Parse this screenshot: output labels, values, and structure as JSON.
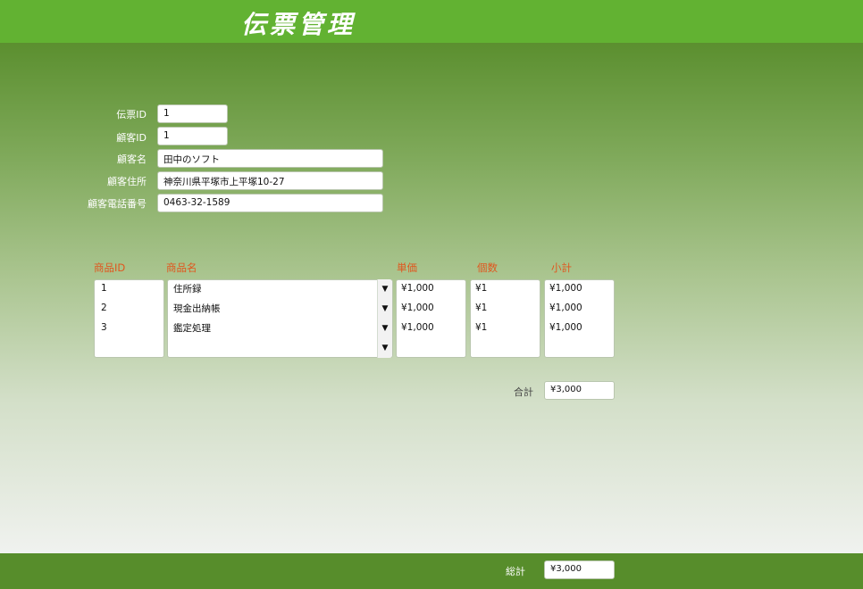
{
  "header": {
    "title": "伝票管理"
  },
  "form": {
    "voucher_id": {
      "label": "伝票ID",
      "value": "1"
    },
    "customer_id": {
      "label": "顧客ID",
      "value": "1"
    },
    "customer_name": {
      "label": "顧客名",
      "value": "田中のソフト"
    },
    "customer_address": {
      "label": "顧客住所",
      "value": "神奈川県平塚市上平塚10-27"
    },
    "customer_phone": {
      "label": "顧客電話番号",
      "value": "0463-32-1589"
    }
  },
  "items": {
    "headers": {
      "id": "商品ID",
      "name": "商品名",
      "price": "単価",
      "qty": "個数",
      "subtotal": "小計"
    },
    "rows": [
      {
        "id": "1",
        "name": "住所録",
        "price": "¥1,000",
        "qty": "¥1",
        "subtotal": "¥1,000"
      },
      {
        "id": "2",
        "name": "現金出納帳",
        "price": "¥1,000",
        "qty": "¥1",
        "subtotal": "¥1,000"
      },
      {
        "id": "3",
        "name": "鑑定処理",
        "price": "¥1,000",
        "qty": "¥1",
        "subtotal": "¥1,000"
      }
    ],
    "dropdown_icon": "triangle-down"
  },
  "summary": {
    "label": "合計",
    "value": "¥3,000"
  },
  "footer": {
    "label": "総計",
    "value": "¥3,000"
  },
  "colors": {
    "header": "#62b232",
    "footer": "#578d2b",
    "column_header": "#e0561e"
  }
}
